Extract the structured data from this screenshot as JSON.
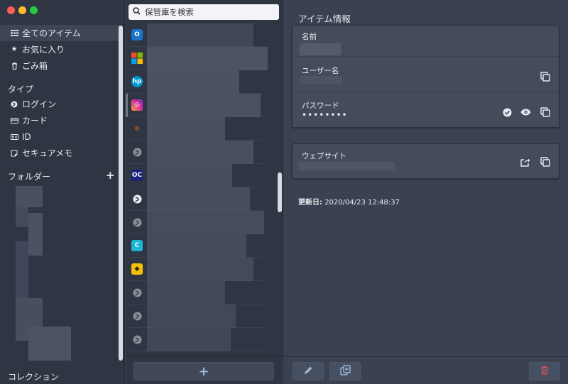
{
  "sidebar": {
    "items": [
      {
        "label": "全てのアイテム",
        "icon": "grid-icon"
      },
      {
        "label": "お気に入り",
        "icon": "star-icon"
      },
      {
        "label": "ごみ箱",
        "icon": "trash-icon"
      }
    ],
    "types_heading": "タイプ",
    "types": [
      {
        "label": "ログイン",
        "icon": "globe-icon"
      },
      {
        "label": "カード",
        "icon": "credit-card-icon"
      },
      {
        "label": "ID",
        "icon": "id-card-icon"
      },
      {
        "label": "セキュアメモ",
        "icon": "note-icon"
      }
    ],
    "folders_heading": "フォルダー",
    "collections_heading": "コレクション"
  },
  "list": {
    "search_placeholder": "保管庫を検索",
    "items": [
      {
        "icon": "outlook-icon",
        "color": "#1a73c8"
      },
      {
        "icon": "microsoft-icon",
        "color": "#f25022"
      },
      {
        "icon": "hp-icon",
        "color": "#0096d6"
      },
      {
        "icon": "instagram-icon",
        "color": "#d6249f"
      },
      {
        "icon": "bird-icon",
        "color": "#7a4a2a"
      },
      {
        "icon": "globe-icon",
        "color": "#8a8f99"
      },
      {
        "icon": "ocp-icon",
        "color": "#1a237e"
      },
      {
        "icon": "globe-icon",
        "color": "#e8ebf0"
      },
      {
        "icon": "globe-icon",
        "color": "#8a8f99"
      },
      {
        "icon": "c-app-icon",
        "color": "#1ab6d3"
      },
      {
        "icon": "yamato-icon",
        "color": "#f2c200"
      },
      {
        "icon": "globe-icon",
        "color": "#8a8f99"
      },
      {
        "icon": "globe-icon",
        "color": "#8a8f99"
      },
      {
        "icon": "globe-icon",
        "color": "#8a8f99"
      }
    ],
    "add_label": "+"
  },
  "detail": {
    "title": "アイテム情報",
    "name_label": "名前",
    "username_label": "ユーザー名",
    "password_label": "パスワード",
    "password_mask": "••••••••",
    "website_label": "ウェブサイト",
    "updated_label": "更新日:",
    "updated_value": "2020/04/23 12:48:37"
  },
  "colors": {
    "sidebar_bg": "#2f3542",
    "detail_bg": "#3a4150",
    "accent": "#9fb5d6",
    "danger": "#c9555b"
  }
}
